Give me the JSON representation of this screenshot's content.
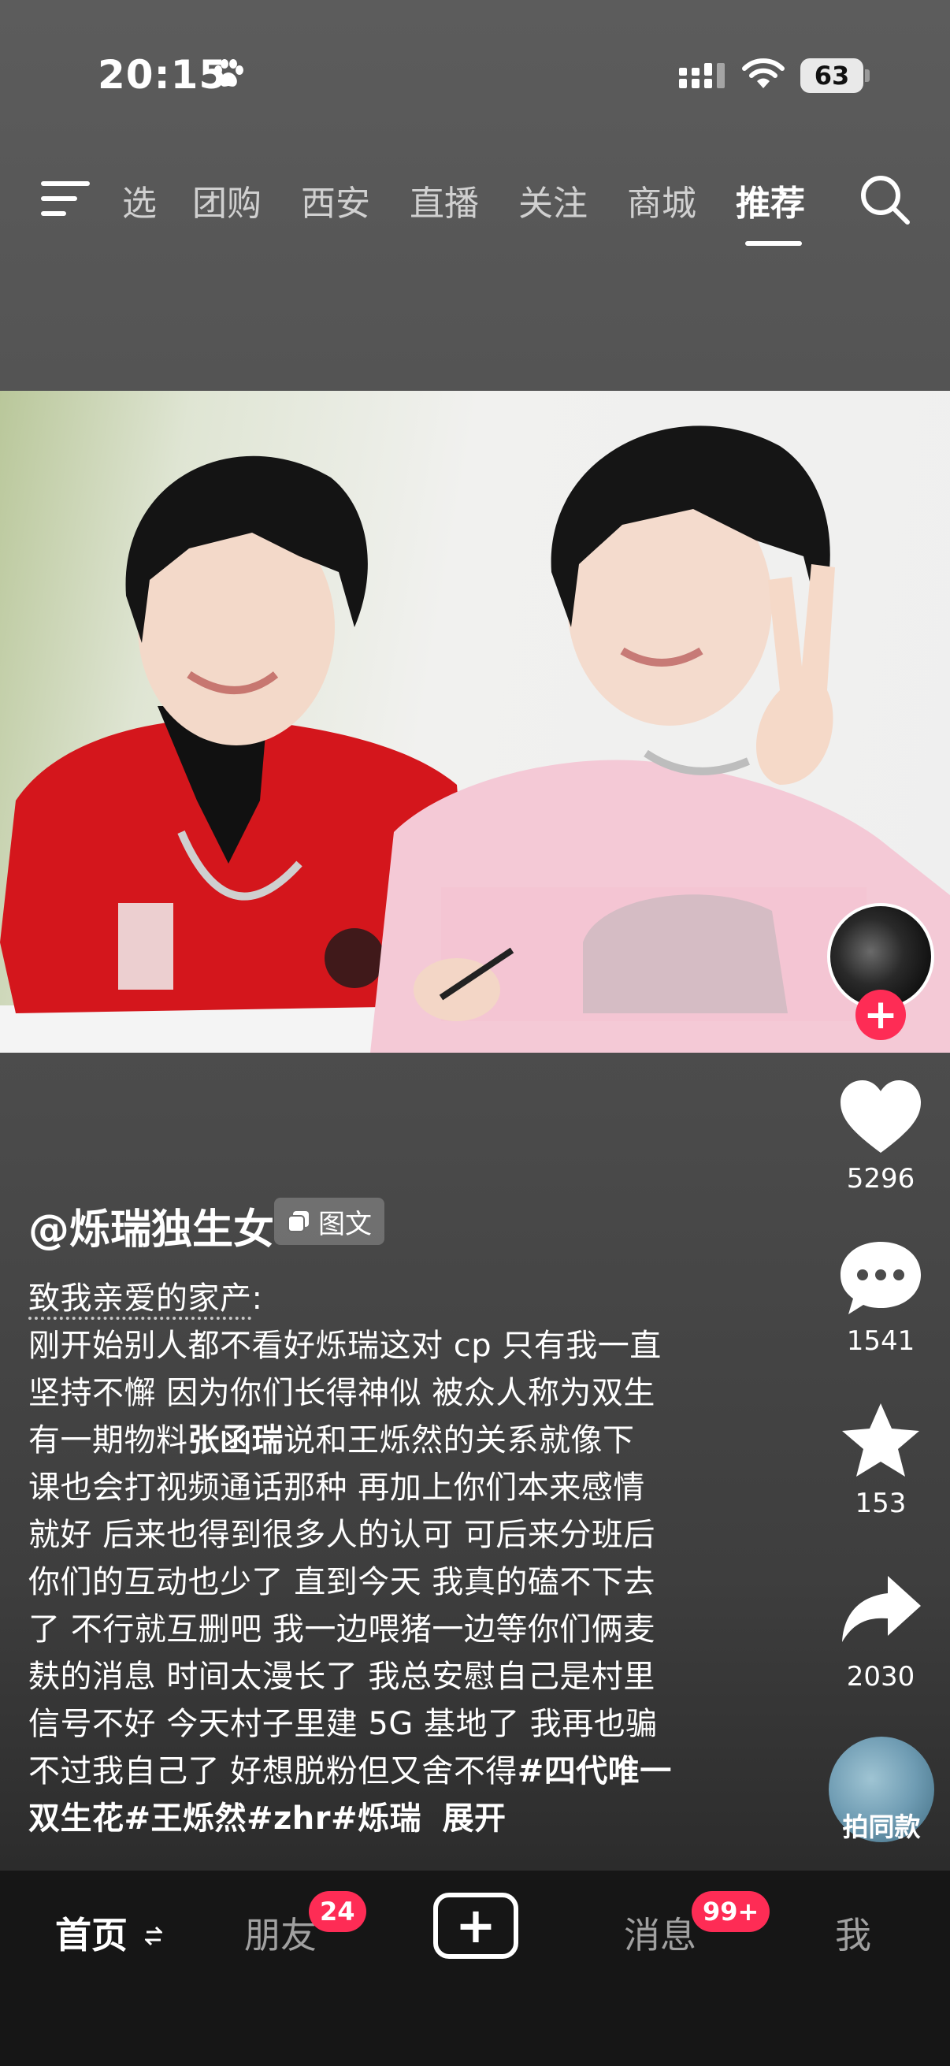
{
  "status_bar": {
    "time": "20:15",
    "battery": "63"
  },
  "top_nav": {
    "tabs": [
      {
        "label": "选"
      },
      {
        "label": "团购"
      },
      {
        "label": "西安"
      },
      {
        "label": "直播"
      },
      {
        "label": "关注"
      },
      {
        "label": "商城"
      },
      {
        "label": "推荐"
      }
    ],
    "active_tab": "推荐"
  },
  "post": {
    "author": "@烁瑞独生女",
    "type_badge": "图文",
    "caption": {
      "title": "致我亲爱的家产",
      "title_suffix": ":",
      "lines": [
        "刚开始别人都不看好烁瑞这对 cp 只有我一直",
        "坚持不懈 因为你们长得神似 被众人称为双生",
        "说和王烁然的关系就像下",
        "课也会打视频通话那种 再加上你们本来感情",
        "就好 后来也得到很多人的认可 可后来分班后",
        "你们的互动也少了 直到今天 我真的磕不下去",
        "了 不行就互删吧 我一边喂猪一边等你们俩麦",
        "麸的消息 时间太漫长了 我总安慰自己是村里",
        "信号不好 今天村子里建 5G 基地了 我再也骗",
        "不过我自己了 好想脱粉但又舍不得"
      ],
      "line3_prefix": "有一期物料",
      "line3_bold": "张函瑞",
      "hashtag_1": "#四代唯一",
      "hashtag_1_cont": "双生花",
      "hashtags_rest": "#王烁然#zhr#烁瑞",
      "expand": "展开"
    }
  },
  "actions": {
    "likes": "5296",
    "comments": "1541",
    "favorites": "153",
    "shares": "2030",
    "same_style": "拍同款"
  },
  "bottom_nav": {
    "home": "首页",
    "friends": "朋友",
    "friends_badge": "24",
    "messages": "消息",
    "messages_badge": "99+",
    "me": "我"
  },
  "colors": {
    "accent": "#fe2c55",
    "bottom_bar": "#161616"
  }
}
